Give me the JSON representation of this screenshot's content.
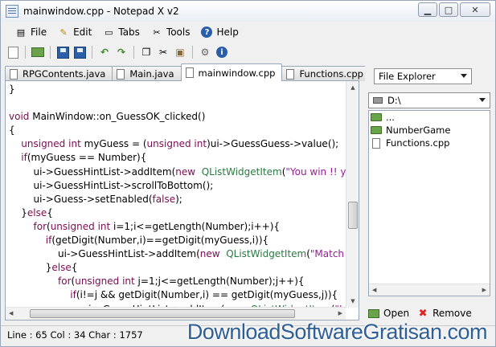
{
  "window": {
    "title": "mainwindow.cpp - Notepad X v2"
  },
  "menu": [
    {
      "label": "File",
      "icon": "file-menu-icon"
    },
    {
      "label": "Edit",
      "icon": "pencil-icon"
    },
    {
      "label": "Tabs",
      "icon": "tabs-icon"
    },
    {
      "label": "Tools",
      "icon": "tools-icon"
    },
    {
      "label": "Help",
      "icon": "help-icon"
    }
  ],
  "tabs": [
    {
      "label": "RPGContents.java",
      "active": false
    },
    {
      "label": "Main.java",
      "active": false
    },
    {
      "label": "mainwindow.cpp",
      "active": true
    },
    {
      "label": "Functions.cpp",
      "active": false
    }
  ],
  "code_lines": [
    "}",
    "",
    "void MainWindow::on_GuessOK_clicked()",
    "{",
    "    unsigned int myGuess = (unsigned int)ui->GuessGuess->value();",
    "    if(myGuess == Number){",
    "        ui->GuessHintList->addItem(new  QListWidgetItem(\"You win !! y",
    "        ui->GuessHintList->scrollToBottom();",
    "        ui->Guess->setEnabled(false);",
    "    }else{",
    "        for(unsigned int i=1;i<=getLength(Number);i++){",
    "            if(getDigit(Number,i)==getDigit(myGuess,i)){",
    "                ui->GuessHintList->addItem(new  QListWidgetItem(\"Match",
    "            }else{",
    "                for(unsigned int j=1;j<=getLength(Number);j++){",
    "                    if(i!=j && getDigit(Number,i) == getDigit(myGuess,j)){",
    "                        ui->GuessHintList->addItem(new  QListWidgetItem(\"I"
  ],
  "panel": {
    "mode": "File Explorer",
    "drive": "D:\\",
    "files": [
      {
        "name": "...",
        "type": "folder"
      },
      {
        "name": "NumberGame",
        "type": "folder"
      },
      {
        "name": "Functions.cpp",
        "type": "file"
      }
    ],
    "open_label": "Open",
    "remove_label": "Remove"
  },
  "status": {
    "text": "Line : 65 Col : 34 Char : 1757"
  },
  "watermark": "DownloadSoftwareGratisan.com"
}
